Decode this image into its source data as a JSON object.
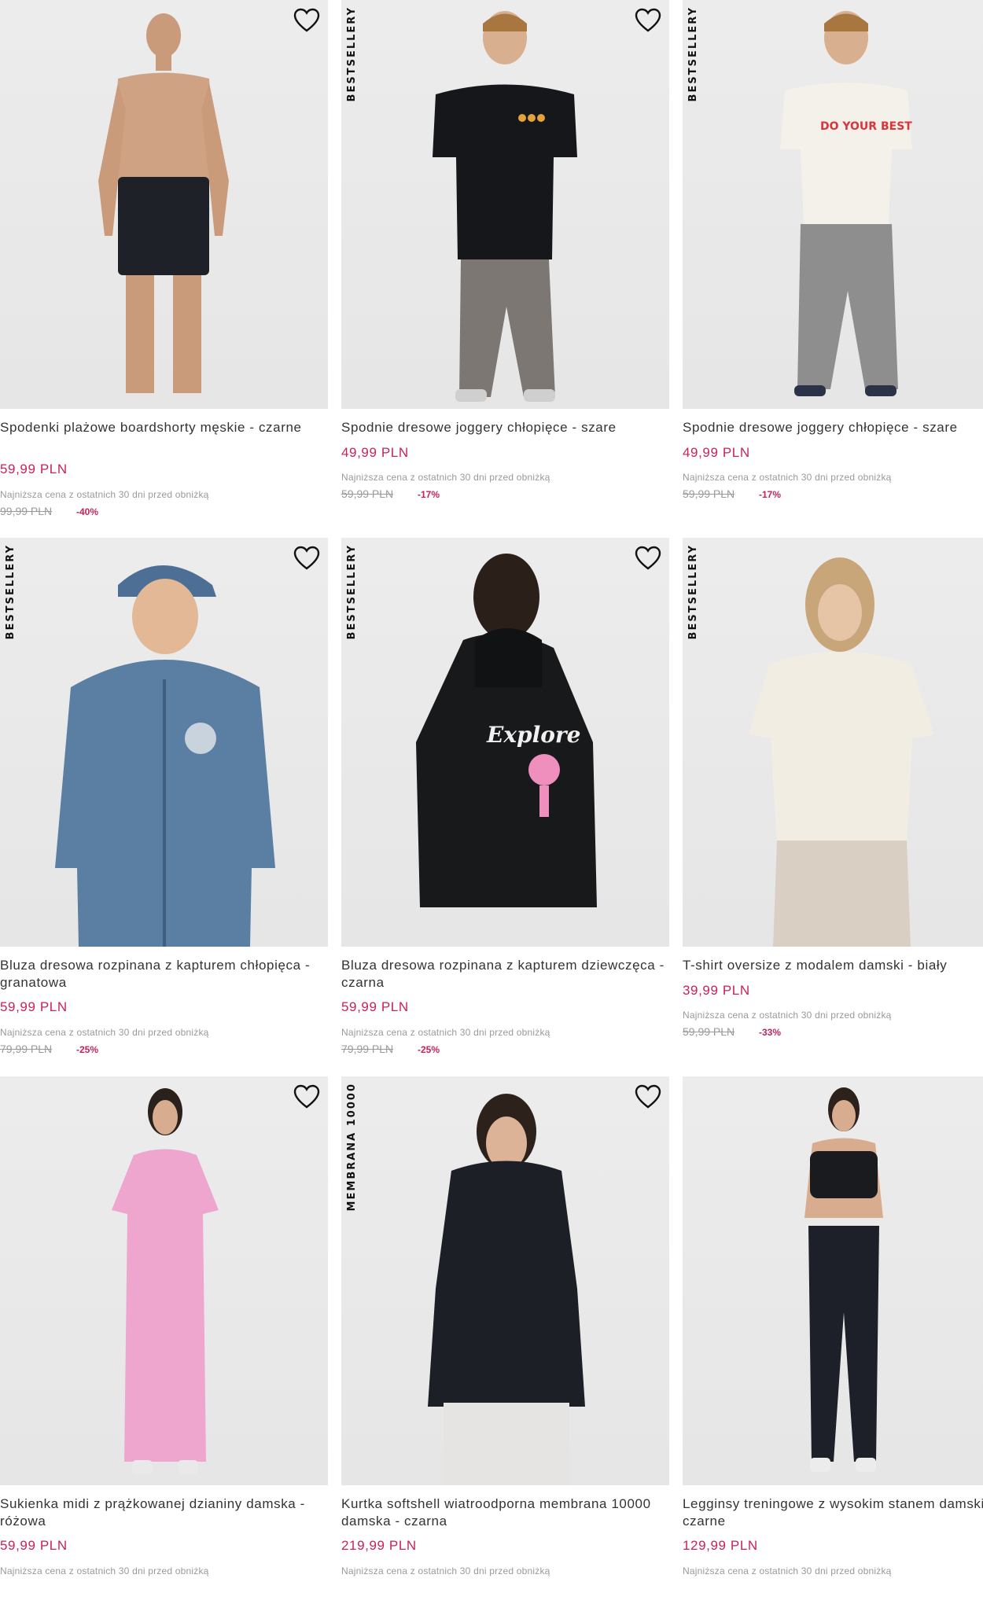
{
  "colors": {
    "price": "#c8225a",
    "muted": "#9a9a9a",
    "photo_bg": "#e8e8e8"
  },
  "products": [
    {
      "badge": "",
      "name": "Spodenki plażowe boardshorty męskie - czarne",
      "price": "59,99 PLN",
      "lowest_note": "Najniższa cena z ostatnich 30 dni przed obniżką",
      "old_price": "99,99 PLN",
      "discount": "-40%",
      "icon": "heart-icon"
    },
    {
      "badge": "BESTSELLERY",
      "name": "Spodnie dresowe joggery chłopięce - szare",
      "price": "49,99 PLN",
      "lowest_note": "Najniższa cena z ostatnich 30 dni przed obniżką",
      "old_price": "59,99 PLN",
      "discount": "-17%",
      "icon": "heart-icon"
    },
    {
      "badge": "BESTSELLERY",
      "name": "Spodnie dresowe joggery chłopięce - szare",
      "price": "49,99 PLN",
      "lowest_note": "Najniższa cena z ostatnich 30 dni przed obniżką",
      "old_price": "59,99 PLN",
      "discount": "-17%",
      "icon": "heart-icon"
    },
    {
      "badge": "BESTSELLERY",
      "name": "Bluza dresowa rozpinana z kapturem chłopięca - granatowa",
      "price": "59,99 PLN",
      "lowest_note": "Najniższa cena z ostatnich 30 dni przed obniżką",
      "old_price": "79,99 PLN",
      "discount": "-25%",
      "icon": "heart-icon"
    },
    {
      "badge": "BESTSELLERY",
      "name": "Bluza dresowa rozpinana z kapturem dziewczęca - czarna",
      "price": "59,99 PLN",
      "lowest_note": "Najniższa cena z ostatnich 30 dni przed obniżką",
      "old_price": "79,99 PLN",
      "discount": "-25%",
      "icon": "heart-icon"
    },
    {
      "badge": "BESTSELLERY",
      "name": "T-shirt oversize z modalem damski - biały",
      "price": "39,99 PLN",
      "lowest_note": "Najniższa cena z ostatnich 30 dni przed obniżką",
      "old_price": "59,99 PLN",
      "discount": "-33%",
      "icon": "heart-icon"
    },
    {
      "badge": "",
      "name": "Sukienka midi z prążkowanej dzianiny damska - różowa",
      "price": "59,99 PLN",
      "lowest_note": "Najniższa cena z ostatnich 30 dni przed obniżką",
      "old_price": "",
      "discount": "",
      "icon": "heart-icon"
    },
    {
      "badge": "MEMBRANA 10000",
      "name": "Kurtka softshell wiatroodporna membrana 10000 damska - czarna",
      "price": "219,99 PLN",
      "lowest_note": "Najniższa cena z ostatnich 30 dni przed obniżką",
      "old_price": "",
      "discount": "",
      "icon": "heart-icon"
    },
    {
      "badge": "",
      "name": "Legginsy treningowe z wysokim stanem damskie - czarne",
      "price": "129,99 PLN",
      "lowest_note": "Najniższa cena z ostatnich 30 dni przed obniżką",
      "old_price": "",
      "discount": "",
      "icon": "heart-icon"
    }
  ]
}
